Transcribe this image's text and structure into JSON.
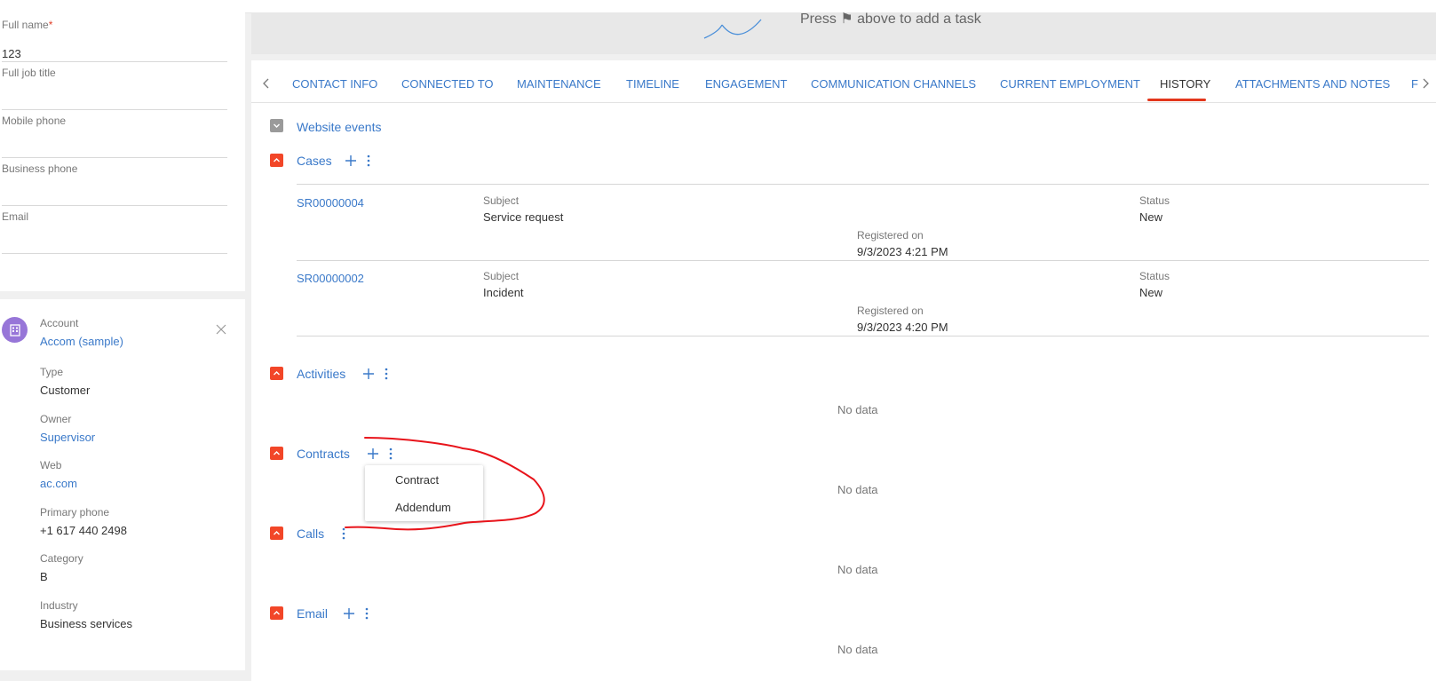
{
  "contact_fields": [
    {
      "label": "Full name",
      "required_mark": "*",
      "value": "123"
    },
    {
      "label": "Full job title",
      "value": ""
    },
    {
      "label": "Mobile phone",
      "value": ""
    },
    {
      "label": "Business phone",
      "value": ""
    },
    {
      "label": "Email",
      "value": ""
    }
  ],
  "account": {
    "label": "Account",
    "name": "Accom (sample)",
    "type_label": "Type",
    "type": "Customer",
    "owner_label": "Owner",
    "owner": "Supervisor",
    "web_label": "Web",
    "web": "ac.com",
    "phone_label": "Primary phone",
    "phone": "+1 617 440 2498",
    "category_label": "Category",
    "category": "B",
    "industry_label": "Industry",
    "industry": "Business services",
    "avatar_color": "#9776d8"
  },
  "task_hint": "Press ⚑ above to add a task",
  "tabs": [
    {
      "label": "CONTACT INFO"
    },
    {
      "label": "CONNECTED TO"
    },
    {
      "label": "MAINTENANCE"
    },
    {
      "label": "TIMELINE"
    },
    {
      "label": "ENGAGEMENT"
    },
    {
      "label": "COMMUNICATION CHANNELS"
    },
    {
      "label": "CURRENT EMPLOYMENT"
    },
    {
      "label": "HISTORY",
      "active": true
    },
    {
      "label": "ATTACHMENTS AND NOTES"
    },
    {
      "label": "F"
    }
  ],
  "sections": {
    "website_events": "Website events",
    "cases": "Cases",
    "activities": "Activities",
    "contracts": "Contracts",
    "calls": "Calls",
    "email": "Email"
  },
  "cases": [
    {
      "id": "SR00000004",
      "subject_label": "Subject",
      "subject": "Service request",
      "status_label": "Status",
      "status": "New",
      "registered_label": "Registered on",
      "registered": "9/3/2023 4:21 PM"
    },
    {
      "id": "SR00000002",
      "subject_label": "Subject",
      "subject": "Incident",
      "status_label": "Status",
      "status": "New",
      "registered_label": "Registered on",
      "registered": "9/3/2023 4:20 PM"
    }
  ],
  "no_data": "No data",
  "contracts_menu": [
    {
      "label": "Contract"
    },
    {
      "label": "Addendum"
    }
  ],
  "colors": {
    "accent_link": "#3a79c9",
    "section_toggle": "#f24628",
    "active_tab_underline": "#e3371c",
    "annotation": "#e8141b"
  }
}
